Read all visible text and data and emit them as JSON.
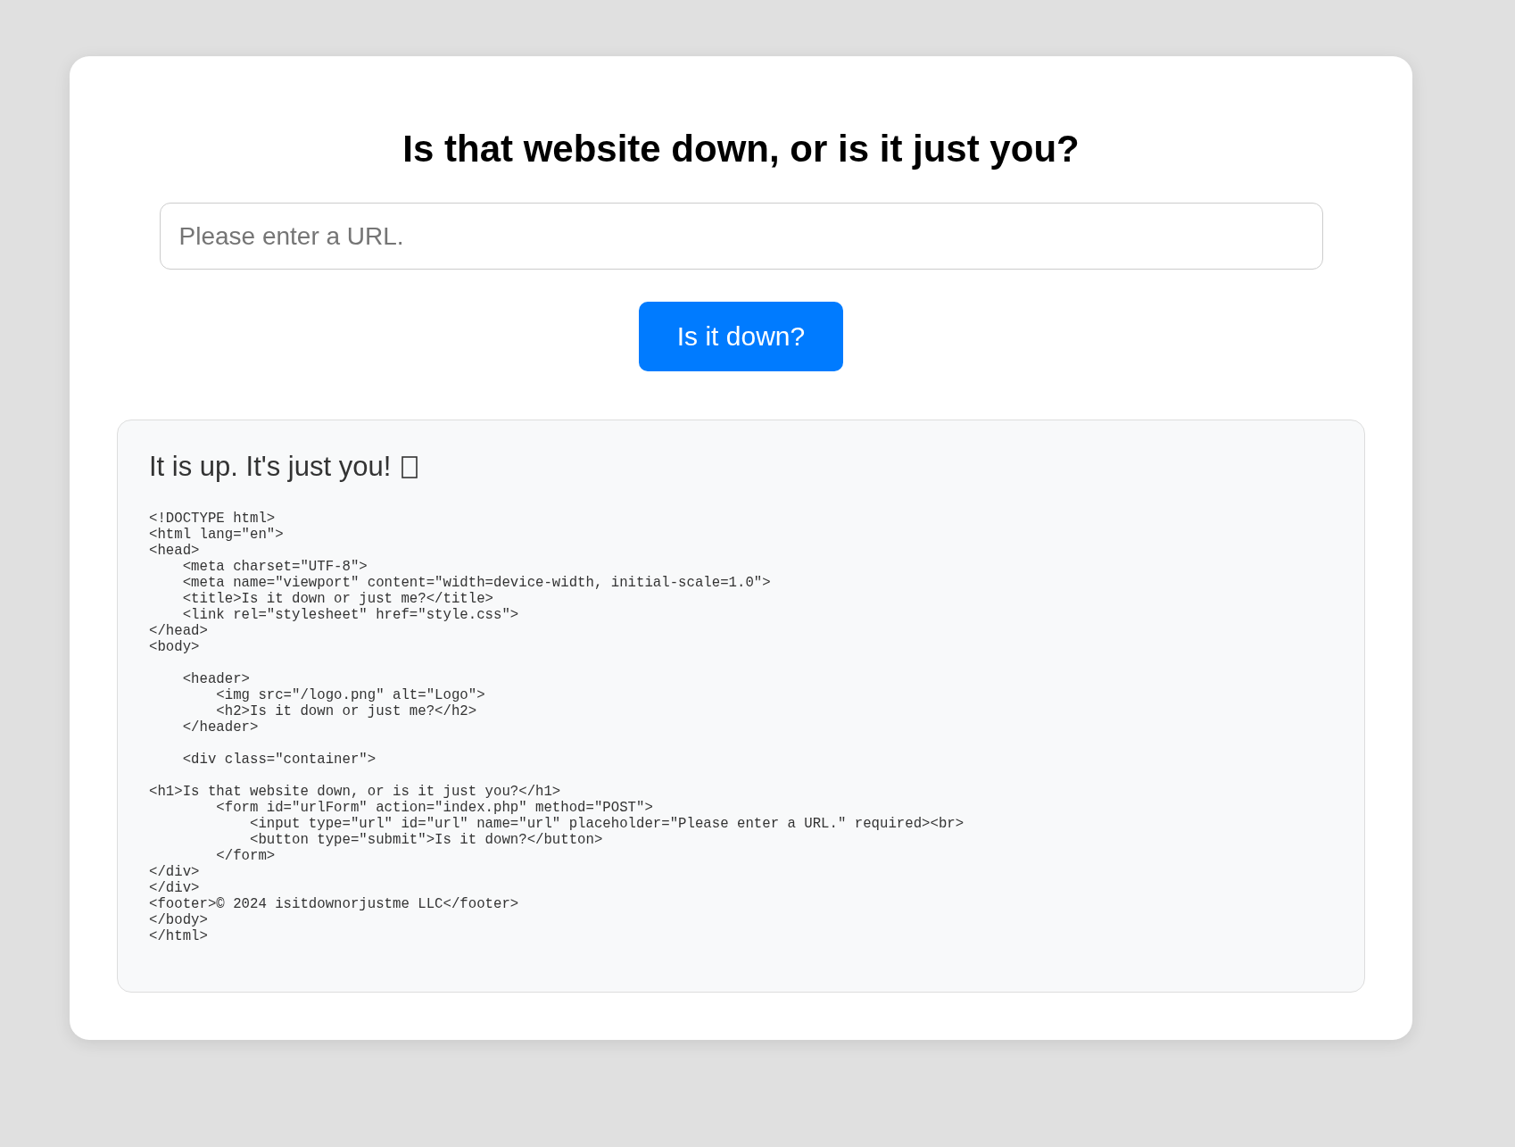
{
  "heading": "Is that website down, or is it just you?",
  "url_field": {
    "placeholder": "Please enter a URL."
  },
  "submit_button": {
    "label": "Is it down?"
  },
  "result": {
    "message": "It is up. It's just you!",
    "source_code": "<!DOCTYPE html>\n<html lang=\"en\">\n<head>\n    <meta charset=\"UTF-8\">\n    <meta name=\"viewport\" content=\"width=device-width, initial-scale=1.0\">\n    <title>Is it down or just me?</title>\n    <link rel=\"stylesheet\" href=\"style.css\">\n</head>\n<body>\n\n    <header>\n        <img src=\"/logo.png\" alt=\"Logo\">\n        <h2>Is it down or just me?</h2>\n    </header>\n\n    <div class=\"container\">\n\n<h1>Is that website down, or is it just you?</h1>\n        <form id=\"urlForm\" action=\"index.php\" method=\"POST\">\n            <input type=\"url\" id=\"url\" name=\"url\" placeholder=\"Please enter a URL.\" required><br>\n            <button type=\"submit\">Is it down?</button>\n        </form>\n</div>\n</div>\n<footer>© 2024 isitdownorjustme LLC</footer>\n</body>\n</html>"
  }
}
